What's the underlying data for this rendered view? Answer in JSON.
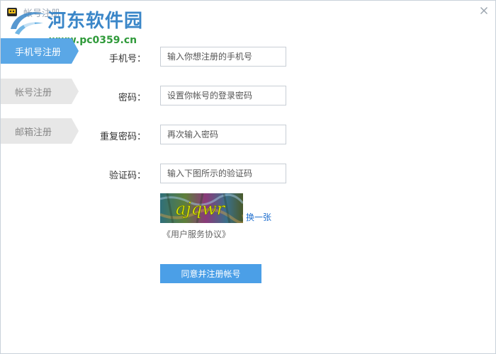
{
  "window": {
    "title": "帐号注册"
  },
  "watermark": {
    "site_name": "河东软件园",
    "url": "www.pc0359.cn"
  },
  "sidebar": {
    "tabs": [
      {
        "label": "手机号注册",
        "active": true
      },
      {
        "label": "帐号注册",
        "active": false
      },
      {
        "label": "邮箱注册",
        "active": false
      }
    ]
  },
  "form": {
    "phone": {
      "label": "手机号：",
      "placeholder": "输入你想注册的手机号"
    },
    "password": {
      "label": "密码：",
      "placeholder": "设置你帐号的登录密码"
    },
    "confirm_password": {
      "label": "重复密码：",
      "placeholder": "再次输入密码"
    },
    "captcha": {
      "label": "验证码：",
      "placeholder": "输入下图所示的验证码",
      "image_text": "ajqwr"
    },
    "refresh_link": "换一张",
    "agreement_link": "《用户服务协议》",
    "submit_label": "同意并注册帐号"
  },
  "colors": {
    "accent": "#4b9fe7",
    "active_tab": "#5aa7e6",
    "inactive_tab": "#e7e7e7",
    "link": "#1f6fcf"
  }
}
